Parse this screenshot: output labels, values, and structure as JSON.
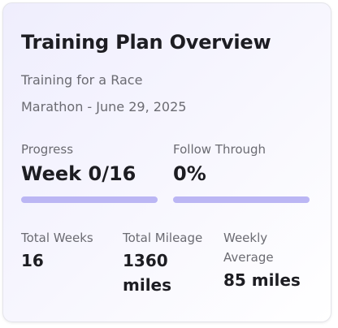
{
  "card": {
    "title": "Training Plan Overview",
    "subtitle_line1": "Training for a Race",
    "subtitle_line2": "Marathon - June 29, 2025"
  },
  "progress": {
    "label": "Progress",
    "value": "Week 0/16",
    "fraction": 0
  },
  "follow_through": {
    "label": "Follow Through",
    "value": "0%",
    "fraction": 0
  },
  "totals": {
    "total_weeks_label": "Total Weeks",
    "total_weeks_value": "16",
    "total_mileage_label": "Total Mileage",
    "total_mileage_value": "1360 miles",
    "weekly_average_label": "Weekly Average",
    "weekly_average_value": "85 miles"
  },
  "colors": {
    "bar_track": "#bbb6f4",
    "bar_fill": "#7c72e8",
    "title_text": "#1d1d22",
    "muted_text": "#6b6b72"
  }
}
